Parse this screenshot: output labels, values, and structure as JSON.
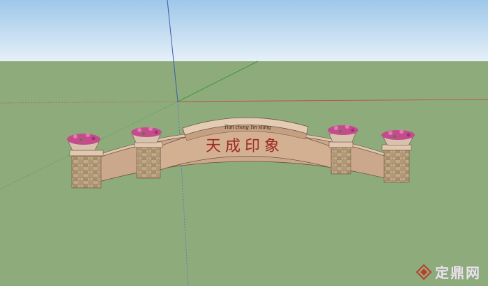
{
  "viewport": {
    "label": "3D model viewport"
  },
  "sign": {
    "chinese": "天成印象",
    "pinyin": "Tian cheng  Yin xiang"
  },
  "watermark": {
    "text": "定鼎网",
    "logo_icon": "diamond-logo-icon"
  },
  "colors": {
    "sky_top": "#9dc7e9",
    "sky_bottom": "#e6f0f8",
    "ground": "#8eac7b",
    "wall": "#cba88c",
    "cap": "#e0c7ae",
    "stone": "#b89f7e",
    "text_red": "#9e2a1f",
    "flowers": "#c44c8c"
  }
}
